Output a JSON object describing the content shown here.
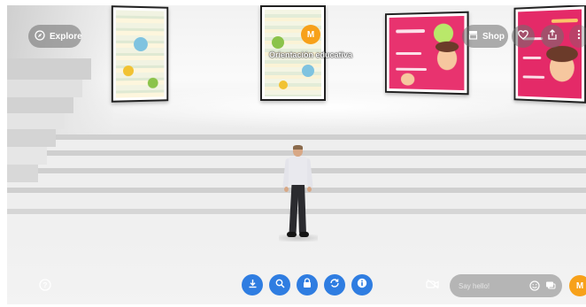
{
  "header": {
    "explore_label": "Explore",
    "shop_label": "Shop"
  },
  "host": {
    "initial": "M",
    "name": "Orientación educativa"
  },
  "toolbar": {
    "tools": [
      {
        "name": "download",
        "icon": "download-icon"
      },
      {
        "name": "zoom",
        "icon": "zoom-icon"
      },
      {
        "name": "lock",
        "icon": "lock-icon"
      },
      {
        "name": "rotate",
        "icon": "rotate-icon"
      },
      {
        "name": "info",
        "icon": "info-icon"
      }
    ]
  },
  "chat": {
    "placeholder": "Say hello!",
    "emoji_icon": "emoji-icon",
    "messages_icon": "chat-icon"
  },
  "user": {
    "initial": "M"
  },
  "icons": {
    "explore": "compass-icon",
    "shop": "store-icon",
    "heart": "heart-icon",
    "share": "share-icon",
    "more": "more-vertical-icon",
    "help": "help-icon",
    "camera": "camera-icon"
  },
  "colors": {
    "accent_blue": "#2f7de1",
    "avatar_orange": "#f7a11a",
    "poster_pink": "#e42a68"
  }
}
